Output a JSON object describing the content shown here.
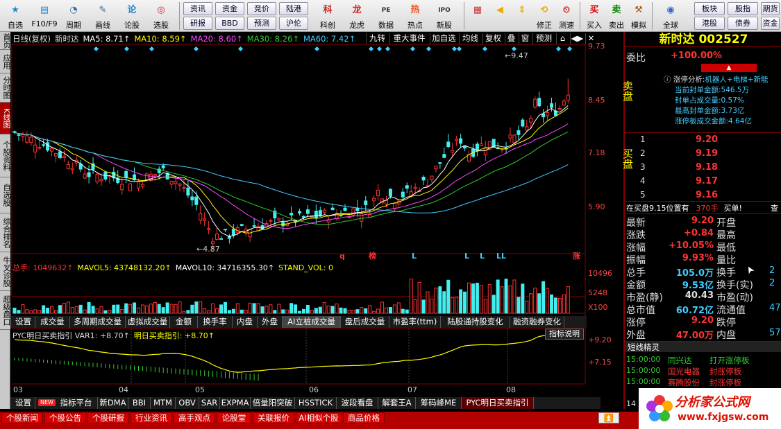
{
  "toolbar": {
    "items": [
      {
        "label": "自选",
        "icon": "star-icon"
      },
      {
        "label": "F10/F9",
        "icon": "f10-icon"
      },
      {
        "label": "周期",
        "icon": "clock-icon"
      },
      {
        "label": "画线",
        "icon": "pencil-icon"
      },
      {
        "label": "论股",
        "icon": "lun-icon"
      },
      {
        "label": "选股",
        "icon": "chart-circle-icon"
      }
    ],
    "small_buttons": [
      "资讯",
      "资金",
      "竞价",
      "陆港",
      "研报",
      "BBD",
      "预测",
      "沪伦"
    ],
    "items2": [
      {
        "label": "科创",
        "icon": "kechuang-icon"
      },
      {
        "label": "龙虎",
        "icon": "dragon-icon"
      },
      {
        "label": "数据",
        "icon": "pe-icon"
      },
      {
        "label": "热点",
        "icon": "hot-icon"
      },
      {
        "label": "新股",
        "icon": "ipo-icon"
      }
    ],
    "items3": [
      {
        "label": "",
        "icon": "grid-icon"
      },
      {
        "label": "",
        "icon": "back-arrow-icon"
      },
      {
        "label": "",
        "icon": "up-down-arrow-icon"
      },
      {
        "label": "修正",
        "icon": "fix-icon"
      },
      {
        "label": "测速",
        "icon": "speed-icon"
      },
      {
        "label": "买入",
        "icon": "buy-icon"
      },
      {
        "label": "卖出",
        "icon": "sell-icon"
      },
      {
        "label": "模拟",
        "icon": "hammer-icon"
      },
      {
        "label": "全球",
        "icon": "globe-icon"
      }
    ],
    "right_buttons": [
      "板块",
      "股指",
      "期货",
      "港股",
      "债券",
      "资金"
    ]
  },
  "left_tabs": [
    "首页",
    "应用",
    "分时图",
    "K线图",
    "个股资料",
    "自选股",
    "综合排名",
    "牛叉诊股",
    "超级盘口"
  ],
  "chart": {
    "ma_line": [
      {
        "text": "日线(复权)",
        "color": "#ddd"
      },
      {
        "text": "新时达",
        "color": "#ddd"
      },
      {
        "text": "MA5: 8.71↑",
        "color": "#fff"
      },
      {
        "text": "MA10: 8.59↑",
        "color": "#ff0"
      },
      {
        "text": "MA20: 8.60↑",
        "color": "#f4f"
      },
      {
        "text": "MA30: 8.26↑",
        "color": "#3c3"
      },
      {
        "text": "MA60: 7.42↑",
        "color": "#4cf"
      }
    ],
    "buttons": [
      "九转",
      "重大事件",
      "加自选",
      "均线",
      "复权",
      "叠",
      "窗",
      "预测",
      "⌂",
      "◀▶",
      "✕"
    ],
    "y_axis": [
      "9.73",
      "8.45",
      "7.18",
      "5.90"
    ],
    "high_label": "9.47",
    "low_label": "4.87",
    "markers": [
      {
        "t": "q",
        "c": "#f33"
      },
      {
        "t": "榜",
        "c": "#f33"
      },
      {
        "t": "L",
        "c": "#4cf"
      },
      {
        "t": "L",
        "c": "#4cf"
      },
      {
        "t": "L",
        "c": "#4cf"
      },
      {
        "t": "LL",
        "c": "#4cf"
      },
      {
        "t": "涨",
        "c": "#f33"
      }
    ],
    "vol_line": [
      {
        "text": "总手: 1049632↑",
        "color": "#f33"
      },
      {
        "text": "MAVOL5: 43748132.20↑",
        "color": "#ff0"
      },
      {
        "text": "MAVOL10: 34716355.30↑",
        "color": "#fff"
      },
      {
        "text": "STAND_VOL: 0",
        "color": "#ff0"
      }
    ],
    "vol_axis": [
      "10496",
      "5248",
      "X100"
    ],
    "indicator_tabs": [
      "设置",
      "成交量",
      "多周期成交量",
      "虚拟成交量",
      "金额",
      "换手率",
      "内盘",
      "外盘",
      "AI立桩成交量",
      "盘后成交量",
      "市盈率(ttm)",
      "陆股通持股变化",
      "融资融券变化"
    ],
    "pyc_line": [
      {
        "text": "PYC明日买卖指引 VAR1: +8.70↑",
        "color": "#ddd"
      },
      {
        "text": "明日买卖指引: +8.70↑",
        "color": "#ff0"
      }
    ],
    "pyc_help": "指标说明",
    "pyc_axis": [
      "+9.20",
      "+7.15"
    ],
    "dates": [
      "03",
      "04",
      "05",
      "06",
      "07",
      "08"
    ],
    "bottom_tabs": [
      "设置",
      "NEW",
      "指标平台",
      "新DMA",
      "BBI",
      "MTM",
      "OBV",
      "SAR",
      "EXPMA",
      "倍量阳突破",
      "HSSTICK",
      "波段看盘",
      "解套王A",
      "筹码峰ME",
      "PYC明日买卖指引"
    ]
  },
  "quote": {
    "title": "新时达 002527",
    "weibi_label": "委比",
    "weibi": "+100.00%",
    "limit_title": "涨停分析:",
    "limit_tags": "机器人+电梯+新能",
    "limit_lines": [
      "当前封单金额:546.5万",
      "封单占成交量:0.57%",
      "最高封单金额:3.73亿",
      "涨停板成交金额:4.64亿"
    ],
    "sell_label": "卖盘",
    "buy_label": "买盘",
    "bids": [
      {
        "n": "1",
        "p": "9.20"
      },
      {
        "n": "2",
        "p": "9.19"
      },
      {
        "n": "3",
        "p": "9.18"
      },
      {
        "n": "4",
        "p": "9.17"
      },
      {
        "n": "5",
        "p": "9.16"
      }
    ],
    "bid_note": "在买盘9.15位置有",
    "bid_note_qty": "370手",
    "bid_note_end": "买单!",
    "bid_note_btn": "查",
    "stats": [
      {
        "l": "最新",
        "v": "9.20",
        "vc": "r",
        "l2": "开盘",
        "v2": ""
      },
      {
        "l": "涨跌",
        "v": "+0.84",
        "vc": "r",
        "l2": "最高",
        "v2": ""
      },
      {
        "l": "涨幅",
        "v": "+10.05%",
        "vc": "r",
        "l2": "最低",
        "v2": ""
      },
      {
        "l": "振幅",
        "v": "9.93%",
        "vc": "r",
        "l2": "量比",
        "v2": ""
      },
      {
        "l": "总手",
        "v": "105.0万",
        "vc": "c",
        "l2": "换手",
        "v2": "2"
      },
      {
        "l": "金额",
        "v": "9.53亿",
        "vc": "c",
        "l2": "换手(实)",
        "v2": "2"
      },
      {
        "l": "市盈(静)",
        "v": "40.43",
        "vc": "w",
        "l2": "市盈(动)",
        "v2": ""
      },
      {
        "l": "总市值",
        "v": "60.72亿",
        "vc": "c",
        "l2": "流通值",
        "v2": "47"
      },
      {
        "l": "涨停",
        "v": "9.20",
        "vc": "r",
        "l2": "跌停",
        "v2": ""
      },
      {
        "l": "外盘",
        "v": "47.00万",
        "vc": "r",
        "l2": "内盘",
        "v2": "57"
      }
    ],
    "short_title": "短线精灵",
    "short_rows": [
      {
        "t": "15:00:00",
        "s": "同兴达",
        "e": "打开涨停板",
        "sc": "g",
        "ec": "g"
      },
      {
        "t": "15:00:00",
        "s": "国光电器",
        "e": "封涨停板",
        "sc": "r",
        "ec": "r"
      },
      {
        "t": "15:00:00",
        "s": "赛腾股份",
        "e": "封涨停板",
        "sc": "r",
        "ec": "r"
      }
    ],
    "short_partial": "14"
  },
  "news_tabs": [
    "个股新闻",
    "个股公告",
    "个股研报",
    "行业资讯",
    "高手观点",
    "论股堂",
    "关联报价",
    "AI相似个股",
    "商品价格"
  ],
  "watermark": {
    "title": "分析家公式网",
    "url": "www.fxjgsw.com"
  }
}
